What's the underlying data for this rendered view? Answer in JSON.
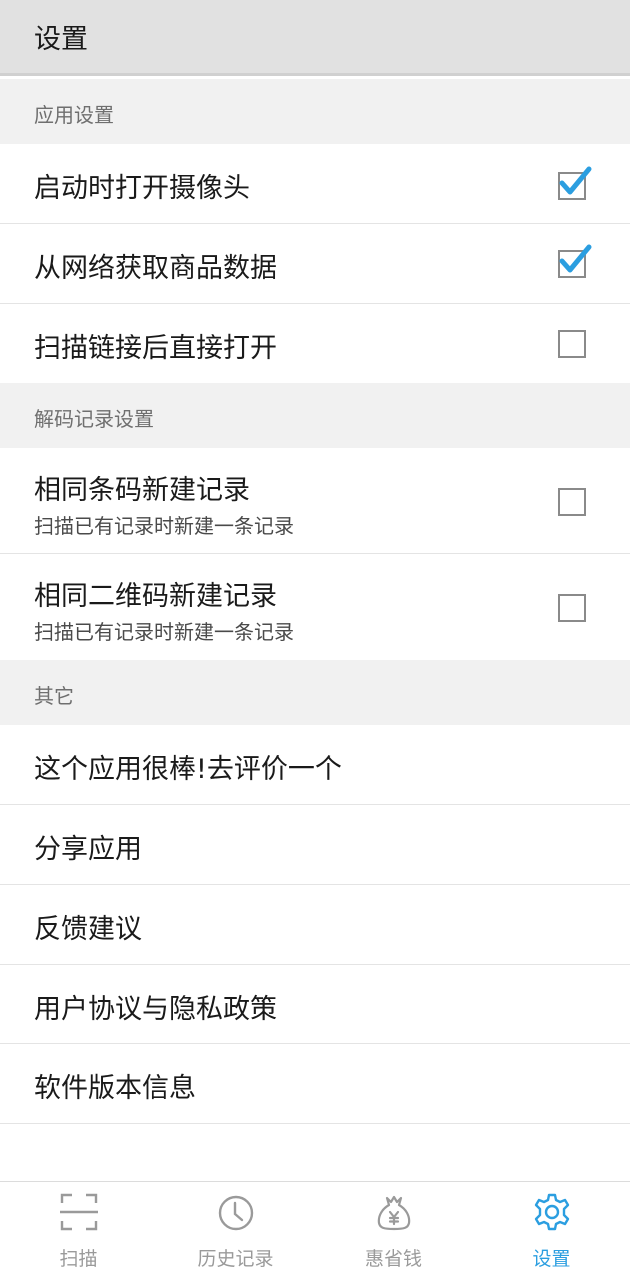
{
  "header": {
    "title": "设置"
  },
  "sections": {
    "app": {
      "title": "应用设置",
      "items": [
        {
          "label": "启动时打开摄像头",
          "checked": true
        },
        {
          "label": "从网络获取商品数据",
          "checked": true
        },
        {
          "label": "扫描链接后直接打开",
          "checked": false
        }
      ]
    },
    "decode": {
      "title": "解码记录设置",
      "items": [
        {
          "label": "相同条码新建记录",
          "sublabel": "扫描已有记录时新建一条记录",
          "checked": false
        },
        {
          "label": "相同二维码新建记录",
          "sublabel": "扫描已有记录时新建一条记录",
          "checked": false
        }
      ]
    },
    "other": {
      "title": "其它",
      "items": [
        {
          "label": "这个应用很棒!去评价一个"
        },
        {
          "label": "分享应用"
        },
        {
          "label": "反馈建议"
        },
        {
          "label": "用户协议与隐私政策"
        },
        {
          "label": "软件版本信息"
        }
      ]
    }
  },
  "bottom_nav": {
    "items": [
      {
        "label": "扫描",
        "icon": "scan-icon",
        "active": false
      },
      {
        "label": "历史记录",
        "icon": "clock-icon",
        "active": false
      },
      {
        "label": "惠省钱",
        "icon": "money-bag-icon",
        "active": false
      },
      {
        "label": "设置",
        "icon": "gear-icon",
        "active": true
      }
    ]
  },
  "colors": {
    "accent": "#2b9ee0",
    "header_bg": "#e1e1e1",
    "section_bg": "#f1f1f1",
    "inactive_nav": "#9a9a9a"
  }
}
